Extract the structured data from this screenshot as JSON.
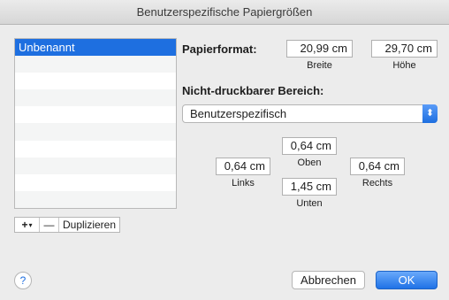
{
  "window": {
    "title": "Benutzerspezifische Papiergrößen"
  },
  "list": {
    "items": [
      "Unbenannt",
      "",
      "",
      "",
      "",
      "",
      "",
      "",
      "",
      ""
    ],
    "selected_index": 0
  },
  "list_controls": {
    "add": "+",
    "add_menu": "▾",
    "remove": "—",
    "duplicate": "Duplizieren"
  },
  "paper": {
    "label": "Papierformat:",
    "width_value": "20,99 cm",
    "width_caption": "Breite",
    "height_value": "29,70 cm",
    "height_caption": "Höhe"
  },
  "nonprintable": {
    "label": "Nicht-druckbarer Bereich:",
    "selected": "Benutzerspezifisch",
    "arrows": "⬍",
    "top_value": "0,64 cm",
    "top_caption": "Oben",
    "left_value": "0,64 cm",
    "left_caption": "Links",
    "right_value": "0,64 cm",
    "right_caption": "Rechts",
    "bottom_value": "1,45 cm",
    "bottom_caption": "Unten"
  },
  "footer": {
    "help": "?",
    "cancel": "Abbrechen",
    "ok": "OK"
  }
}
